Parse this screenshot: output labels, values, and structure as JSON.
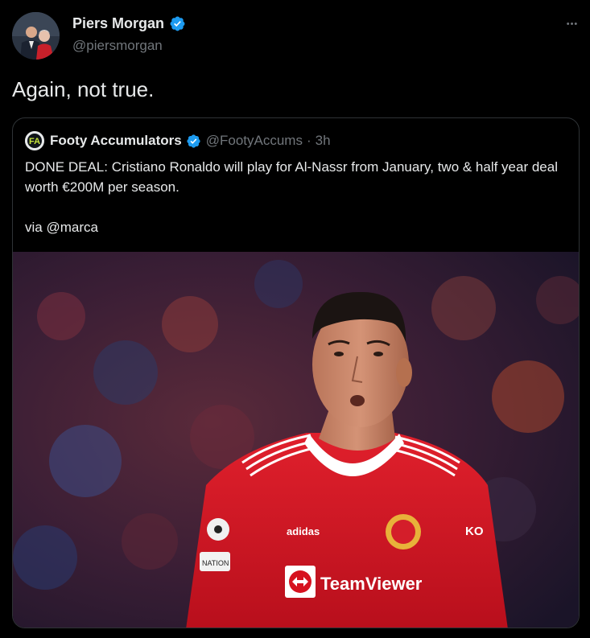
{
  "author": {
    "name": "Piers Morgan",
    "handle": "@piersmorgan",
    "verified_color": "#1d9bf0"
  },
  "menu": {
    "more_label": "•••"
  },
  "tweet": {
    "text": "Again, not true."
  },
  "quote": {
    "name": "Footy Accumulators",
    "handle": "@FootyAccums",
    "separator": "·",
    "time": "3h",
    "lines": [
      "DONE DEAL: Cristiano Ronaldo will play for Al-Nassr from January, two & half year deal worth €200M per season.",
      "via @marca"
    ],
    "image": {
      "shirt_sponsor": "TeamViewer",
      "kit_brand": "adidas",
      "sleeve_text": "KO",
      "badge_text": "NATION"
    }
  },
  "colors": {
    "background": "#000000",
    "text": "#e7e9ea",
    "secondary": "#71767b",
    "border": "#2f3336",
    "verified": "#1d9bf0",
    "shirt_red": "#d6121f"
  }
}
